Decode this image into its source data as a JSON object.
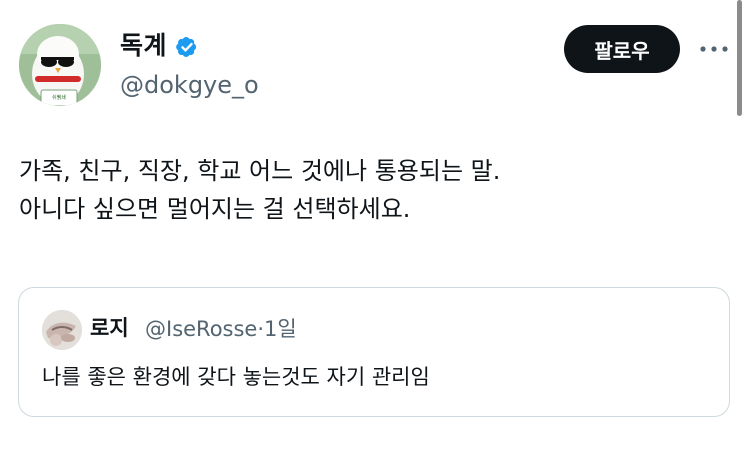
{
  "author": {
    "display_name": "독계",
    "handle": "@dokgye_o",
    "verified": true,
    "avatar_caption": "쉬뷁쇄"
  },
  "actions": {
    "follow_label": "팔로우",
    "more_icon": "more-horizontal-icon"
  },
  "tweet": {
    "lines": [
      "가족, 친구, 직장, 학교 어느 것에나 통용되는 말.",
      "아니다 싶으면 멀어지는 걸 선택하세요."
    ]
  },
  "quote": {
    "display_name": "로지",
    "handle": "@IseRosse",
    "separator": "·",
    "time": "1일",
    "text": "나를 좋은 환경에 갖다 놓는것도 자기 관리임"
  },
  "colors": {
    "text": "#0f1419",
    "secondary": "#536471",
    "verified": "#1d9bf0",
    "border": "#cfd9de",
    "follow_bg": "#0f1419"
  }
}
